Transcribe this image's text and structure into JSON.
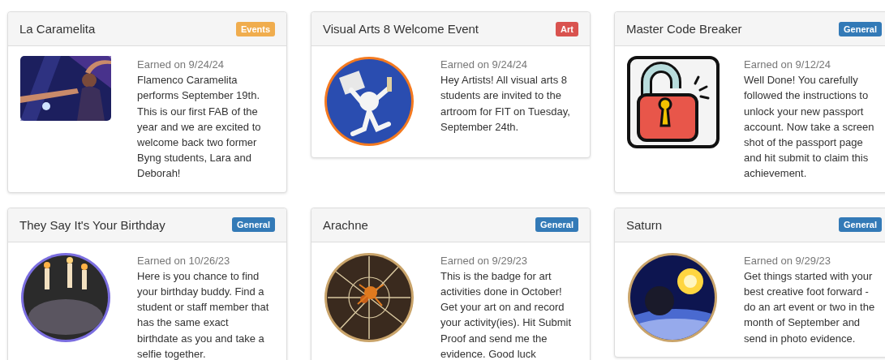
{
  "badges": [
    {
      "title": "La Caramelita",
      "category": "Events",
      "color": "#f0ad4e",
      "image": {
        "kind": "rect"
      },
      "earned": "Earned on 9/24/24",
      "description": "Flamenco Caramelita performs September 19th. This is our first FAB of the year and we are excited to welcome back two former Byng students, Lara and Deborah!"
    },
    {
      "title": "Visual Arts 8 Welcome Event",
      "category": "Art",
      "color": "#d9534f",
      "image": {
        "kind": "round"
      },
      "earned": "Earned on 9/24/24",
      "description": "Hey Artists! All visual arts 8 students are invited to the artroom for FIT on Tuesday, September 24th."
    },
    {
      "title": "Master Code Breaker",
      "category": "General",
      "color": "#337ab7",
      "image": {
        "kind": "lock"
      },
      "earned": "Earned on 9/12/24",
      "description": "Well Done! You carefully followed the instructions to unlock your new passport account. Now take a screen shot of the passport page and hit submit to claim this achievement."
    },
    {
      "title": "They Say It's Your Birthday",
      "category": "General",
      "color": "#337ab7",
      "image": {
        "kind": "round"
      },
      "earned": "Earned on 10/26/23",
      "description": "Here is you chance to find your birthday buddy. Find a student or staff member that has the same exact birthdate as you and take a selfie together."
    },
    {
      "title": "Arachne",
      "category": "General",
      "color": "#337ab7",
      "image": {
        "kind": "round"
      },
      "earned": "Earned on 9/29/23",
      "description": "This is the badge for art activities done in October! Get your art on and record your activity(ies). Hit Submit Proof and send me the evidence. Good luck"
    },
    {
      "title": "Saturn",
      "category": "General",
      "color": "#337ab7",
      "image": {
        "kind": "round"
      },
      "earned": "Earned on 9/29/23",
      "description": "Get things started with your best creative foot forward - do an art event or two in the month of September and send in photo evidence."
    }
  ]
}
